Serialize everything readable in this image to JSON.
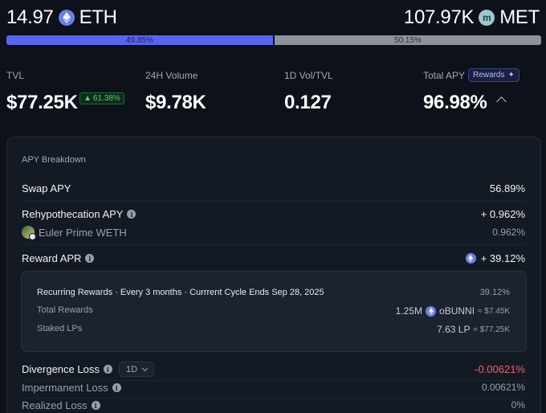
{
  "tokens": {
    "left": {
      "amount": "14.97",
      "symbol": "ETH",
      "icon": "eth-icon"
    },
    "right": {
      "amount": "107.97K",
      "symbol": "MET",
      "icon": "met-icon",
      "icon_letter": "m"
    }
  },
  "ratio": {
    "left_label": "49.85%",
    "right_label": "50.15%",
    "left_fraction": 0.4985
  },
  "stats": {
    "tvl": {
      "label": "TVL",
      "value": "$77.25K",
      "change": "61.38%"
    },
    "volume": {
      "label": "24H Volume",
      "value": "$9.78K"
    },
    "vol_tvl": {
      "label": "1D Vol/TVL",
      "value": "0.127"
    },
    "apy": {
      "label": "Total APY",
      "value": "96.98%",
      "badge": "Rewards"
    }
  },
  "breakdown": {
    "title": "APY Breakdown",
    "swap": {
      "label": "Swap APY",
      "value": "56.89%"
    },
    "rehyp": {
      "label": "Rehypothecation APY",
      "value": "+ 0.962%"
    },
    "euler": {
      "label": "Euler Prime WETH",
      "value": "0.962%"
    },
    "reward": {
      "label": "Reward APR",
      "value": "+ 39.12%"
    },
    "inner": {
      "recurring": {
        "label": "Recurring Rewards · Every 3 months · Currrent Cycle Ends Sep 28, 2025",
        "value": "39.12%"
      },
      "total": {
        "label": "Total Rewards",
        "amount": "1.25M",
        "token": "oBUNNI",
        "usd": "≈ $7.45K"
      },
      "staked": {
        "label": "Staked LPs",
        "value": "7.63 LP",
        "usd": "≈ $77.25K"
      }
    },
    "divergence": {
      "label": "Divergence Loss",
      "period": "1D",
      "value": "-0.00621%"
    },
    "impermanent": {
      "label": "Impermanent Loss",
      "value": "0.00621%"
    },
    "realized": {
      "label": "Realized Loss",
      "value": "0%"
    }
  },
  "colors": {
    "accent": "#5865f2",
    "positive": "#3ddc7a",
    "negative": "#f0606a",
    "background": "#0c111a"
  }
}
